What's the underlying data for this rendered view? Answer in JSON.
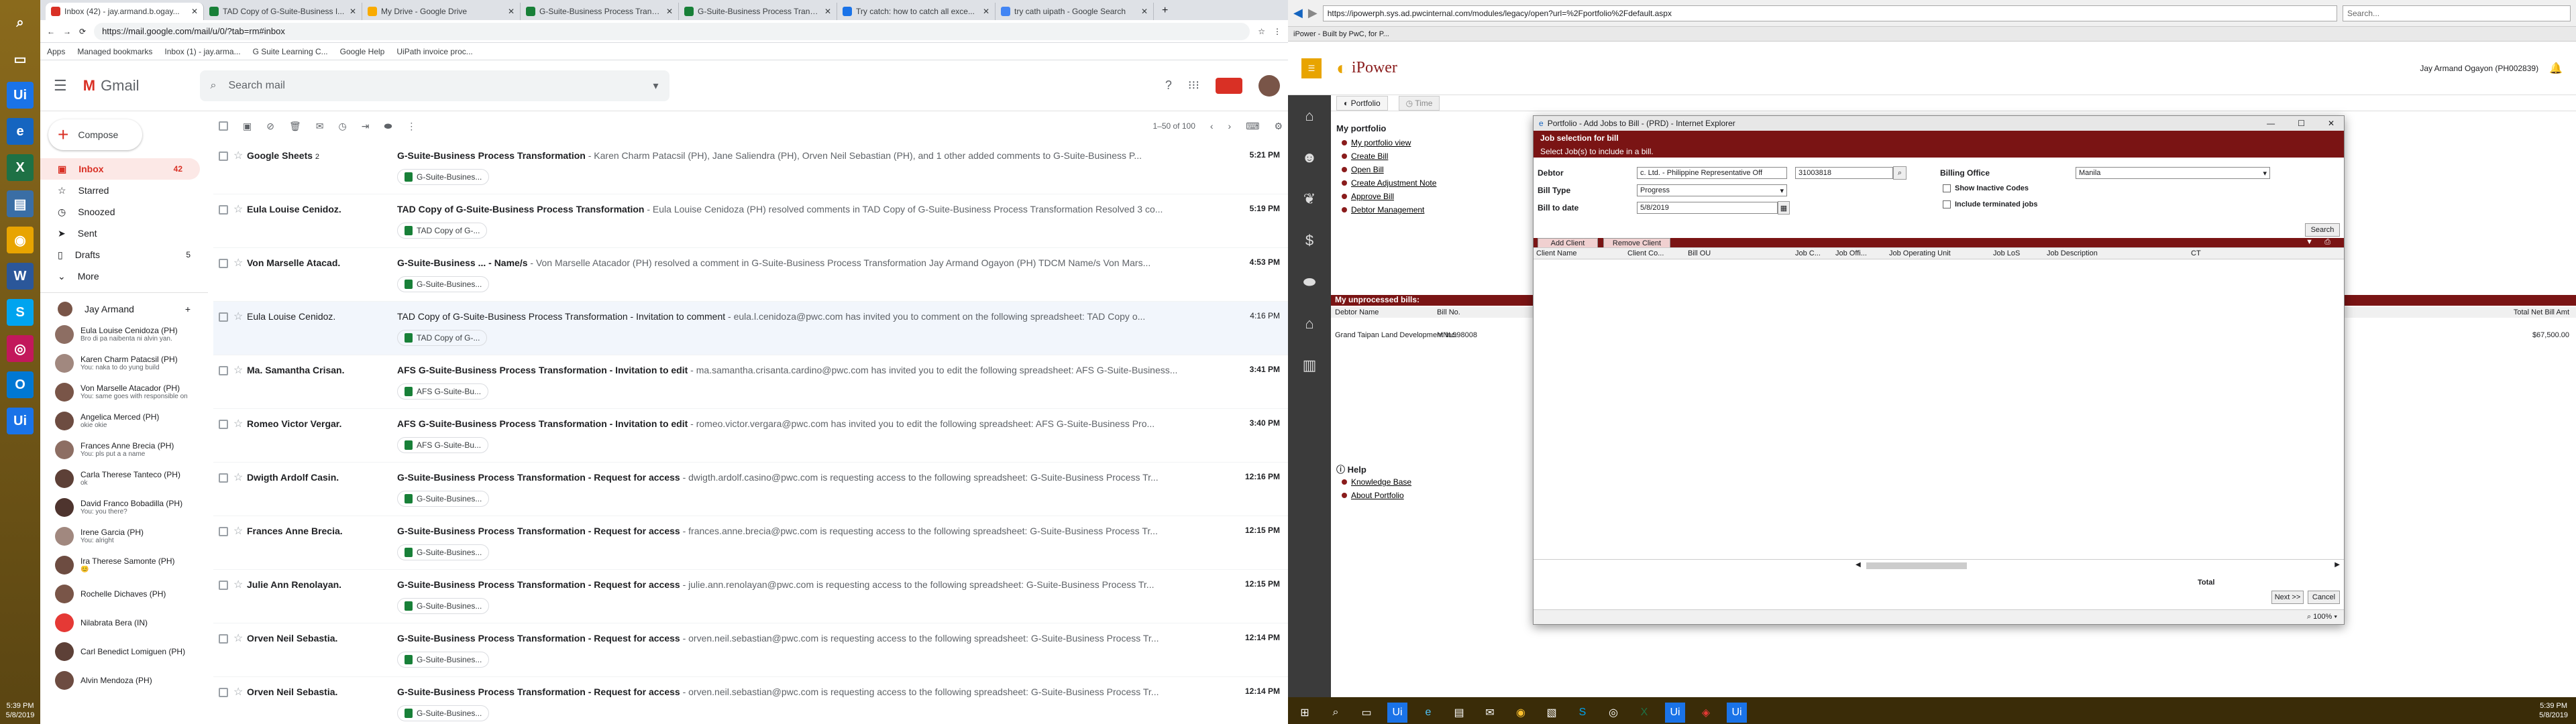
{
  "taskbar": {
    "clock_time": "5:39 PM",
    "clock_date": "5/8/2019",
    "ui_label": "Ui"
  },
  "chrome": {
    "tabs": [
      {
        "title": "Inbox (42) - jay.armand.b.ogay...",
        "color": "#d93025"
      },
      {
        "title": "TAD Copy of G-Suite-Business I...",
        "color": "#188038"
      },
      {
        "title": "My Drive - Google Drive",
        "color": "#f9ab00"
      },
      {
        "title": "G-Suite-Business Process Transf...",
        "color": "#188038"
      },
      {
        "title": "G-Suite-Business Process Transf...",
        "color": "#188038"
      },
      {
        "title": "Try catch: how to catch all exce...",
        "color": "#1a73e8"
      },
      {
        "title": "try cath uipath - Google Search",
        "color": "#4285f4"
      }
    ],
    "url": "https://mail.google.com/mail/u/0/?tab=rm#inbox",
    "bookmarks": [
      "Apps",
      "Managed bookmarks",
      "Inbox (1) - jay.arma...",
      "G Suite Learning C...",
      "Google Help",
      "UiPath invoice proc..."
    ]
  },
  "gmail": {
    "logo": "Gmail",
    "search_placeholder": "Search mail",
    "compose": "Compose",
    "nav": [
      {
        "label": "Inbox",
        "count": "42",
        "selected": true
      },
      {
        "label": "Starred",
        "count": ""
      },
      {
        "label": "Snoozed",
        "count": ""
      },
      {
        "label": "Sent",
        "count": ""
      },
      {
        "label": "Drafts",
        "count": "5"
      },
      {
        "label": "More",
        "count": ""
      }
    ],
    "hangouts_user": "Jay Armand",
    "contacts": [
      {
        "name": "Eula Louise Cenidoza (PH)",
        "msg": "Bro di pa naibenta ni alvin yan.",
        "color": "#8d6e63"
      },
      {
        "name": "Karen Charm Patacsil (PH)",
        "msg": "You: naka to do yung build",
        "color": "#a1887f"
      },
      {
        "name": "Von Marselle Atacador (PH)",
        "msg": "You: same goes with responsible on",
        "color": "#795548"
      },
      {
        "name": "Angelica Merced (PH)",
        "msg": "okie okie",
        "color": "#6d4c41"
      },
      {
        "name": "Frances Anne Brecia (PH)",
        "msg": "You: pls put a a name",
        "color": "#8d6e63"
      },
      {
        "name": "Carla Therese Tanteco (PH)",
        "msg": "ok",
        "color": "#5d4037"
      },
      {
        "name": "David Franco Bobadilla (PH)",
        "msg": "You: you there?",
        "color": "#4e342e"
      },
      {
        "name": "Irene Garcia (PH)",
        "msg": "You: alright",
        "color": "#a1887f"
      },
      {
        "name": "Ira Therese Samonte (PH)",
        "msg": "😊",
        "color": "#6d4c41"
      },
      {
        "name": "Rochelle Dichaves (PH)",
        "msg": "",
        "color": "#795548"
      },
      {
        "name": "Nilabrata Bera (IN)",
        "msg": "",
        "color": "#e53935"
      },
      {
        "name": "Carl Benedict Lomiguen (PH)",
        "msg": "",
        "color": "#5d4037"
      },
      {
        "name": "Alvin Mendoza (PH)",
        "msg": "",
        "color": "#6d4c41"
      }
    ],
    "pagination": "1–50 of 100",
    "emails": [
      {
        "sender": "Google Sheets",
        "count": "2",
        "subject": "G-Suite-Business Process Transformation",
        "snippet": " - Karen Charm Patacsil (PH), Jane Saliendra (PH), Orven Neil Sebastian (PH), and 1 other added comments to G-Suite-Business P...",
        "chip": "G-Suite-Busines...",
        "time": "5:21 PM",
        "read": false
      },
      {
        "sender": "Eula Louise Cenidoz.",
        "count": "",
        "subject": "TAD Copy of G-Suite-Business Process Transformation",
        "snippet": " - Eula Louise Cenidoza (PH) resolved comments in TAD Copy of G-Suite-Business Process Transformation Resolved 3 co...",
        "chip": "TAD Copy of G-...",
        "time": "5:19 PM",
        "read": false
      },
      {
        "sender": "Von Marselle Atacad.",
        "count": "",
        "subject": "G-Suite-Business ... - Name/s",
        "snippet": " - Von Marselle Atacador (PH) resolved a comment in G-Suite-Business Process Transformation Jay Armand Ogayon (PH) TDCM Name/s Von Mars...",
        "chip": "G-Suite-Busines...",
        "time": "4:53 PM",
        "read": false
      },
      {
        "sender": "Eula Louise Cenidoz.",
        "count": "",
        "subject": "TAD Copy of G-Suite-Business Process Transformation - Invitation to comment",
        "snippet": " - eula.l.cenidoza@pwc.com has invited you to comment on the following spreadsheet: TAD Copy o...",
        "chip": "TAD Copy of G-...",
        "time": "4:16 PM",
        "read": true
      },
      {
        "sender": "Ma. Samantha Crisan.",
        "count": "",
        "subject": "AFS G-Suite-Business Process Transformation - Invitation to edit",
        "snippet": " - ma.samantha.crisanta.cardino@pwc.com has invited you to edit the following spreadsheet: AFS G-Suite-Business...",
        "chip": "AFS G-Suite-Bu...",
        "time": "3:41 PM",
        "read": false
      },
      {
        "sender": "Romeo Victor Vergar.",
        "count": "",
        "subject": "AFS G-Suite-Business Process Transformation - Invitation to edit",
        "snippet": " - romeo.victor.vergara@pwc.com has invited you to edit the following spreadsheet: AFS G-Suite-Business Pro...",
        "chip": "AFS G-Suite-Bu...",
        "time": "3:40 PM",
        "read": false
      },
      {
        "sender": "Dwigth Ardolf Casin.",
        "count": "",
        "subject": "G-Suite-Business Process Transformation - Request for access",
        "snippet": " - dwigth.ardolf.casino@pwc.com is requesting access to the following spreadsheet: G-Suite-Business Process Tr...",
        "chip": "G-Suite-Busines...",
        "time": "12:16 PM",
        "read": false
      },
      {
        "sender": "Frances Anne Brecia.",
        "count": "",
        "subject": "G-Suite-Business Process Transformation - Request for access",
        "snippet": " - frances.anne.brecia@pwc.com is requesting access to the following spreadsheet: G-Suite-Business Process Tr...",
        "chip": "G-Suite-Busines...",
        "time": "12:15 PM",
        "read": false
      },
      {
        "sender": "Julie Ann Renolayan.",
        "count": "",
        "subject": "G-Suite-Business Process Transformation - Request for access",
        "snippet": " - julie.ann.renolayan@pwc.com is requesting access to the following spreadsheet: G-Suite-Business Process Tr...",
        "chip": "G-Suite-Busines...",
        "time": "12:15 PM",
        "read": false
      },
      {
        "sender": "Orven Neil Sebastia.",
        "count": "",
        "subject": "G-Suite-Business Process Transformation - Request for access",
        "snippet": " - orven.neil.sebastian@pwc.com is requesting access to the following spreadsheet: G-Suite-Business Process Tr...",
        "chip": "G-Suite-Busines...",
        "time": "12:14 PM",
        "read": false
      },
      {
        "sender": "Orven Neil Sebastia.",
        "count": "",
        "subject": "G-Suite-Business Process Transformation - Request for access",
        "snippet": " - orven.neil.sebastian@pwc.com is requesting access to the following spreadsheet: G-Suite-Business Process Tr...",
        "chip": "G-Suite-Busines...",
        "time": "12:14 PM",
        "read": false
      }
    ]
  },
  "ie": {
    "url": "https://ipowerph.sys.ad.pwcinternal.com/modules/legacy/open?url=%2Fportfolio%2Fdefault.aspx",
    "search_placeholder": "Search...",
    "tab_title": "iPower - Built by PwC, for P...",
    "ipower": {
      "logo": "iPower",
      "user": "Jay Armand Ogayon (PH002839)",
      "tabs": [
        "Portfolio",
        "Time"
      ],
      "section_title": "My portfolio",
      "links": [
        "My portfolio view",
        "Create Bill",
        "Open Bill",
        "Create Adjustment Note",
        "Approve Bill",
        "Debtor Management"
      ],
      "unprocessed_title": "My unprocessed bills:",
      "unprocessed_cols": [
        "Debtor Name",
        "Bill No."
      ],
      "unprocessed_row": {
        "debtor": "Grand Taipan Land Development Inc.",
        "bill": "MNL998008"
      },
      "total_label": "Total Net Bill Amt",
      "total_value": "$67,500.00",
      "help_title": "Help",
      "help_links": [
        "Knowledge Base",
        "About Portfolio"
      ]
    },
    "modal": {
      "title": "Portfolio - Add Jobs to Bill - (PRD) - Internet Explorer",
      "header": "Job selection for bill",
      "subheader": "Select Job(s) to include in a bill.",
      "debtor_label": "Debtor",
      "debtor_value": "c. Ltd. - Philippine Representative Off",
      "debtor_code": "31003818",
      "bill_type_label": "Bill Type",
      "bill_type_value": "Progress",
      "bill_to_date_label": "Bill to date",
      "bill_to_date_value": "5/8/2019",
      "billing_office_label": "Billing Office",
      "billing_office_value": "Manila",
      "show_inactive": "Show Inactive Codes",
      "include_terminated": "Include terminated jobs",
      "search_btn": "Search",
      "add_client": "Add Client",
      "remove_client": "Remove Client",
      "columns": [
        "Client Name",
        "Client Co...",
        "Bill OU",
        "Job C...",
        "Job Offi...",
        "Job Operating Unit",
        "Job LoS",
        "Job Description",
        "CT"
      ],
      "total_label": "Total",
      "next_btn": "Next >>",
      "cancel_btn": "Cancel",
      "zoom": "100%"
    }
  },
  "bottom_taskbar": {
    "time": "5:39 PM",
    "date": "5/8/2019"
  }
}
